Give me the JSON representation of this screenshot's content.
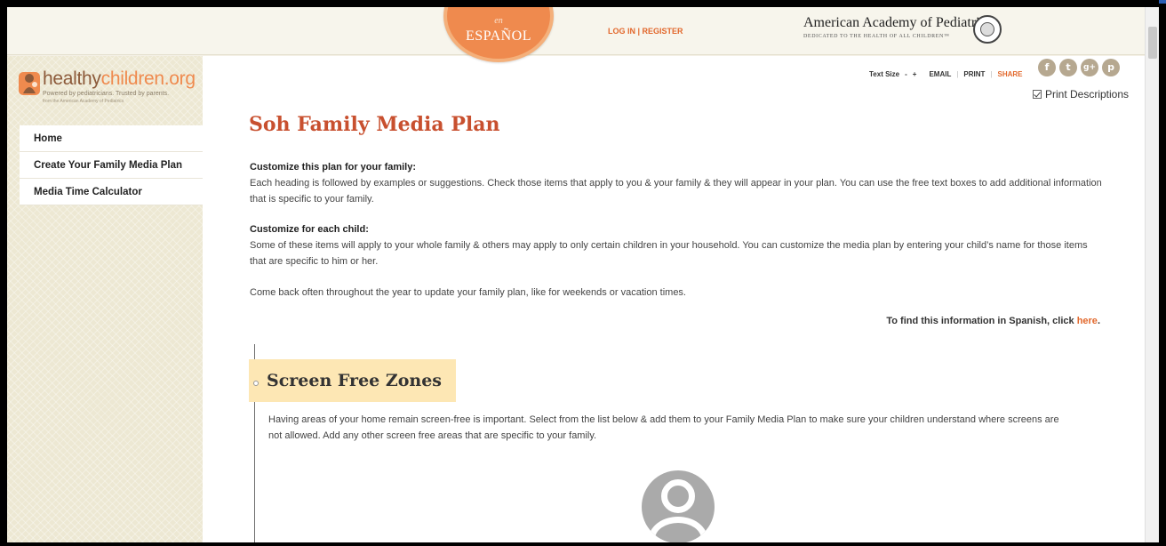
{
  "header": {
    "espanol_small": "en",
    "espanol_label": "ESPAÑOL",
    "login_register": "LOG IN | REGISTER",
    "aap_name": "American Academy of Pediatrics",
    "aap_tagline": "DEDICATED TO THE HEALTH OF ALL CHILDREN™"
  },
  "logo": {
    "word_a": "healthy",
    "word_b": "children.org",
    "tagline": "Powered by pediatricians. Trusted by parents.",
    "tagline2": "from the American Academy of Pediatrics"
  },
  "sidebar": {
    "items": [
      {
        "label": "Home"
      },
      {
        "label": "Create Your Family Media Plan"
      },
      {
        "label": "Media Time Calculator"
      }
    ]
  },
  "tools": {
    "text_size": "Text Size",
    "minus": "-",
    "plus": "+",
    "email": "EMAIL",
    "print": "PRINT",
    "share": "SHARE",
    "print_descriptions": "Print Descriptions"
  },
  "social": [
    {
      "icon": "facebook-icon",
      "glyph": "f"
    },
    {
      "icon": "twitter-icon",
      "glyph": "t"
    },
    {
      "icon": "google-plus-icon",
      "glyph": "g+"
    },
    {
      "icon": "pinterest-icon",
      "glyph": "p"
    }
  ],
  "main": {
    "title": "Soh Family Media Plan",
    "intro1_heading": "Customize this plan for your family:",
    "intro1_body": "Each heading is followed by examples or suggestions. Check those items that apply to you & your family & they will appear in your plan. You can use the free text boxes to add additional information that is specific to your family.",
    "intro2_heading": "Customize for each child:",
    "intro2_body": "Some of these items will apply to your whole family & others may apply to only certain children in your household. You can customize the media plan by entering your child’s name for those items that are specific to him or her.",
    "intro3_body": "Come back often throughout the year to update your family plan, like for weekends or vacation times.",
    "spanish_prefix": "To find this information in Spanish, click ",
    "spanish_link": "here",
    "spanish_suffix": "."
  },
  "section": {
    "title": "Screen Free Zones",
    "body": "Having areas of your home remain screen-free is important. Select from the list below & add them to your Family Media Plan to make sure your children understand where screens are not allowed. Add any other screen free areas that are specific to your family."
  },
  "colors": {
    "accent": "#e2682c",
    "title": "#c8502f",
    "section_bg": "#fde7b4",
    "sidebar_bg": "#ede8d3"
  }
}
